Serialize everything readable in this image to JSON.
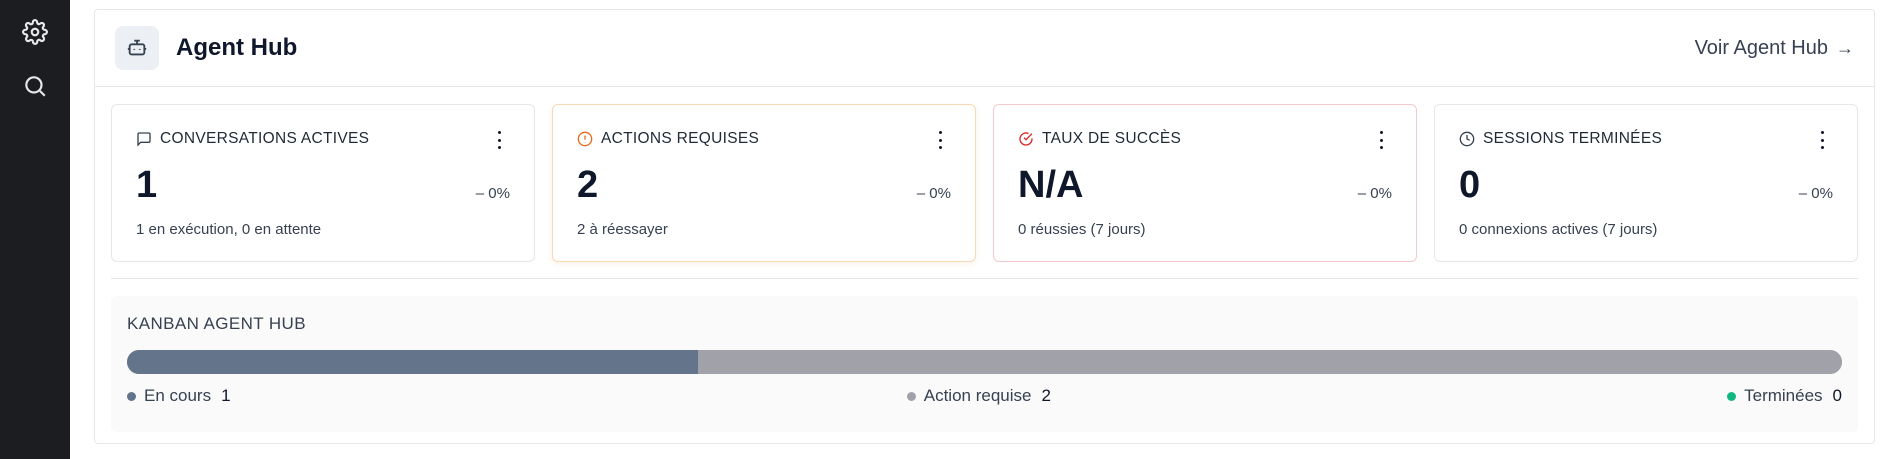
{
  "sidebar": {
    "items": [
      {
        "name": "settings",
        "icon": "gear-icon"
      },
      {
        "name": "search",
        "icon": "search-icon"
      }
    ]
  },
  "header": {
    "icon": "bot-icon",
    "title": "Agent Hub",
    "link_label": "Voir Agent Hub",
    "link_arrow": "→"
  },
  "cards": [
    {
      "icon": "message-square-icon",
      "label": "CONVERSATIONS ACTIVES",
      "value": "1",
      "delta": "– 0%",
      "sub": "1 en exécution, 0 en attente",
      "icon_color": "#374151"
    },
    {
      "icon": "alert-circle-icon",
      "label": "ACTIONS REQUISES",
      "value": "2",
      "delta": "– 0%",
      "sub": "2 à réessayer",
      "icon_color": "#ea6a1a"
    },
    {
      "icon": "check-circle-icon",
      "label": "TAUX DE SUCCÈS",
      "value": "N/A",
      "delta": "– 0%",
      "sub": "0 réussies (7 jours)",
      "icon_color": "#dc2626"
    },
    {
      "icon": "clock-icon",
      "label": "SESSIONS TERMINÉES",
      "value": "0",
      "delta": "– 0%",
      "sub": "0 connexions actives (7 jours)",
      "icon_color": "#374151"
    }
  ],
  "kanban": {
    "title": "KANBAN AGENT HUB",
    "segments": [
      {
        "name": "En cours",
        "count": "1",
        "color": "#64748b",
        "fraction": 0.333
      },
      {
        "name": "Action requise",
        "count": "2",
        "color": "#a1a1aa",
        "fraction": 0.667
      },
      {
        "name": "Terminées",
        "count": "0",
        "color": "#10b981",
        "fraction": 0
      }
    ]
  },
  "colors": {
    "sidebar_bg": "#1c1d20",
    "border": "#e5e7eb",
    "warn_border": "#f8d9b4",
    "error_border": "#f6c9cd"
  }
}
